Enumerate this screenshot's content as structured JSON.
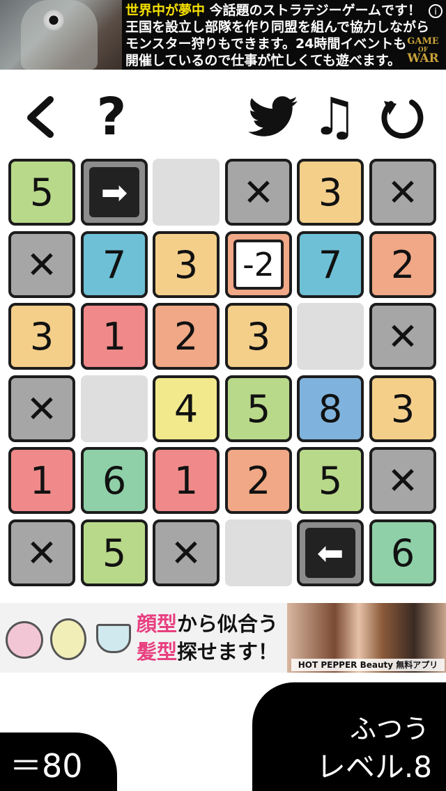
{
  "ad_top": {
    "highlight": "世界中が夢中",
    "line1_rest": " 今話題のストラテジーゲームです！",
    "line2": "王国を設立し部隊を作り同盟を組んで協力しながら",
    "line3": "モンスター狩りもできます。24時間イベントも",
    "line4": "開催しているので仕事が忙しくても遊べます。",
    "logo_line1": "GAME",
    "logo_line2": "OF",
    "logo_line3": "WAR",
    "info": "i"
  },
  "toolbar": {
    "back_icon": "chevron-left-icon",
    "help_label": "?",
    "share_icon": "twitter-bird-icon",
    "sound_label": "♫",
    "restart_icon": "restart-icon"
  },
  "grid": {
    "rows": [
      [
        {
          "t": "num",
          "v": "5",
          "c": "#b9d98a"
        },
        {
          "t": "arrow",
          "v": "➡",
          "c": "#8c8c8c"
        },
        {
          "t": "empty",
          "v": "",
          "c": "#dedede"
        },
        {
          "t": "x",
          "v": "✕",
          "c": "#a6a6a6"
        },
        {
          "t": "num",
          "v": "3",
          "c": "#f4cf8a"
        },
        {
          "t": "x",
          "v": "✕",
          "c": "#a6a6a6"
        }
      ],
      [
        {
          "t": "x",
          "v": "✕",
          "c": "#a6a6a6"
        },
        {
          "t": "num",
          "v": "7",
          "c": "#6ec0d6"
        },
        {
          "t": "num",
          "v": "3",
          "c": "#f4cf8a"
        },
        {
          "t": "neg",
          "v": "-2",
          "c": "#f0a886"
        },
        {
          "t": "num",
          "v": "7",
          "c": "#6ec0d6"
        },
        {
          "t": "num",
          "v": "2",
          "c": "#f0a886"
        }
      ],
      [
        {
          "t": "num",
          "v": "3",
          "c": "#f4cf8a"
        },
        {
          "t": "num",
          "v": "1",
          "c": "#f08a8a"
        },
        {
          "t": "num",
          "v": "2",
          "c": "#f0a886"
        },
        {
          "t": "num",
          "v": "3",
          "c": "#f4cf8a"
        },
        {
          "t": "empty",
          "v": "",
          "c": "#dedede"
        },
        {
          "t": "x",
          "v": "✕",
          "c": "#a6a6a6"
        }
      ],
      [
        {
          "t": "x",
          "v": "✕",
          "c": "#a6a6a6"
        },
        {
          "t": "empty",
          "v": "",
          "c": "#dedede"
        },
        {
          "t": "num",
          "v": "4",
          "c": "#f1e98c"
        },
        {
          "t": "num",
          "v": "5",
          "c": "#b9d98a"
        },
        {
          "t": "num",
          "v": "8",
          "c": "#7fb3dd"
        },
        {
          "t": "num",
          "v": "3",
          "c": "#f4cf8a"
        }
      ],
      [
        {
          "t": "num",
          "v": "1",
          "c": "#f08a8a"
        },
        {
          "t": "num",
          "v": "6",
          "c": "#8fd0a8"
        },
        {
          "t": "num",
          "v": "1",
          "c": "#f08a8a"
        },
        {
          "t": "num",
          "v": "2",
          "c": "#f0a886"
        },
        {
          "t": "num",
          "v": "5",
          "c": "#b9d98a"
        },
        {
          "t": "x",
          "v": "✕",
          "c": "#a6a6a6"
        }
      ],
      [
        {
          "t": "x",
          "v": "✕",
          "c": "#a6a6a6"
        },
        {
          "t": "num",
          "v": "5",
          "c": "#b9d98a"
        },
        {
          "t": "x",
          "v": "✕",
          "c": "#a6a6a6"
        },
        {
          "t": "empty",
          "v": "",
          "c": "#dedede"
        },
        {
          "t": "arrow",
          "v": "⬅",
          "c": "#8c8c8c"
        },
        {
          "t": "num",
          "v": "6",
          "c": "#8fd0a8"
        }
      ]
    ]
  },
  "ad_bottom": {
    "copy_line1_pink": "顔型",
    "copy_line1_rest": "から似合う",
    "copy_line2_pink": "髪型",
    "copy_line2_rest": "探せます！",
    "brand": "HOT PEPPER Beauty 無料アプリ",
    "shape_colors": [
      "#f3c6d6",
      "#f2eeb8",
      "#cfe9ef"
    ]
  },
  "score": {
    "label": "＝80"
  },
  "level": {
    "difficulty": "ふつう",
    "label": "レベル.8"
  }
}
